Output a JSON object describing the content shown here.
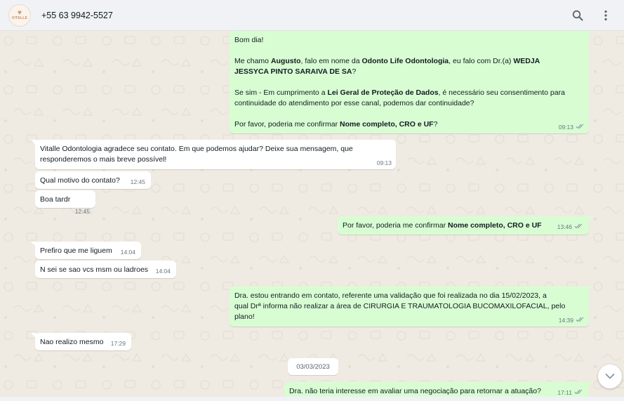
{
  "header": {
    "avatar_brand": "VITALLE",
    "contact_name": "+55 63 9942-5527",
    "icons": [
      "search-icon",
      "menu-icon"
    ]
  },
  "messages": [
    {
      "direction": "out",
      "lines": [
        [
          {
            "t": "Bom dia!"
          }
        ],
        [],
        [
          {
            "t": "Me chamo "
          },
          {
            "t": "Augusto",
            "b": true
          },
          {
            "t": ", falo em nome da "
          },
          {
            "t": "Odonto Life Odontologia",
            "b": true
          },
          {
            "t": ", eu falo com Dr.(a) "
          },
          {
            "t": "WEDJA",
            "b": true
          }
        ],
        [
          {
            "t": "JESSYCA PINTO SARAIVA DE SA",
            "b": true
          },
          {
            "t": "?"
          }
        ],
        [],
        [
          {
            "t": "Se sim - Em cumprimento a "
          },
          {
            "t": "Lei Geral de Proteção de Dados",
            "b": true
          },
          {
            "t": ", é necessário seu consentimento para"
          }
        ],
        [
          {
            "t": "continuidade do atendimento por esse canal, podemos dar continuidade?"
          }
        ],
        [],
        [
          {
            "t": "Por favor, poderia me confirmar "
          },
          {
            "t": "Nome completo, CRO e UF",
            "b": true
          },
          {
            "t": "?"
          }
        ]
      ],
      "time": "09:13"
    },
    {
      "direction": "in",
      "lines": [
        [
          {
            "t": "Vitalle Odontologia agradece seu contato. Em que podemos ajudar? Deixe sua mensagem, que"
          }
        ],
        [
          {
            "t": "responderemos o mais breve possível!"
          }
        ]
      ],
      "time": "09:13"
    },
    {
      "direction": "in",
      "lines": [
        [
          {
            "t": "Qual motivo do contato?"
          }
        ]
      ],
      "time": "12:45"
    },
    {
      "direction": "in",
      "lines": [
        [
          {
            "t": "Boa tardr"
          }
        ]
      ],
      "time": "12:45"
    },
    {
      "direction": "out",
      "lines": [
        [
          {
            "t": "Por favor, poderia me confirmar "
          },
          {
            "t": "Nome completo, CRO e UF",
            "b": true
          }
        ]
      ],
      "time": "13:46"
    },
    {
      "direction": "in",
      "lines": [
        [
          {
            "t": "Prefiro que me liguem"
          }
        ]
      ],
      "time": "14:04"
    },
    {
      "direction": "in",
      "lines": [
        [
          {
            "t": "N sei se sao vcs msm ou ladroes"
          }
        ]
      ],
      "time": "14:04"
    },
    {
      "direction": "out",
      "lines": [
        [
          {
            "t": "Dra. estou entrando em contato, referente uma validação que foi realizada no dia 15/02/2023, a"
          }
        ],
        [
          {
            "t": "qual Drª informa não realizar a área de CIRURGIA E TRAUMATOLOGIA BUCOMAXILOFACIAL, pelo"
          }
        ],
        [
          {
            "t": "plano!"
          }
        ]
      ],
      "time": "14:39"
    },
    {
      "direction": "in",
      "lines": [
        [
          {
            "t": "Nao realizo mesmo"
          }
        ]
      ],
      "time": "17:29"
    },
    {
      "direction": "out",
      "lines": [
        [
          {
            "t": "Dra. não teria interesse em avaliar uma negociação para retornar a atuação?"
          }
        ]
      ],
      "time": "17:11"
    }
  ],
  "date_chip": "03/03/2023",
  "colors": {
    "incoming": "#ffffff",
    "outgoing": "#d9fdd3",
    "background": "#efeae2",
    "ticks": "#8696a0"
  },
  "scroll_down_icon": "chevron-down-icon"
}
